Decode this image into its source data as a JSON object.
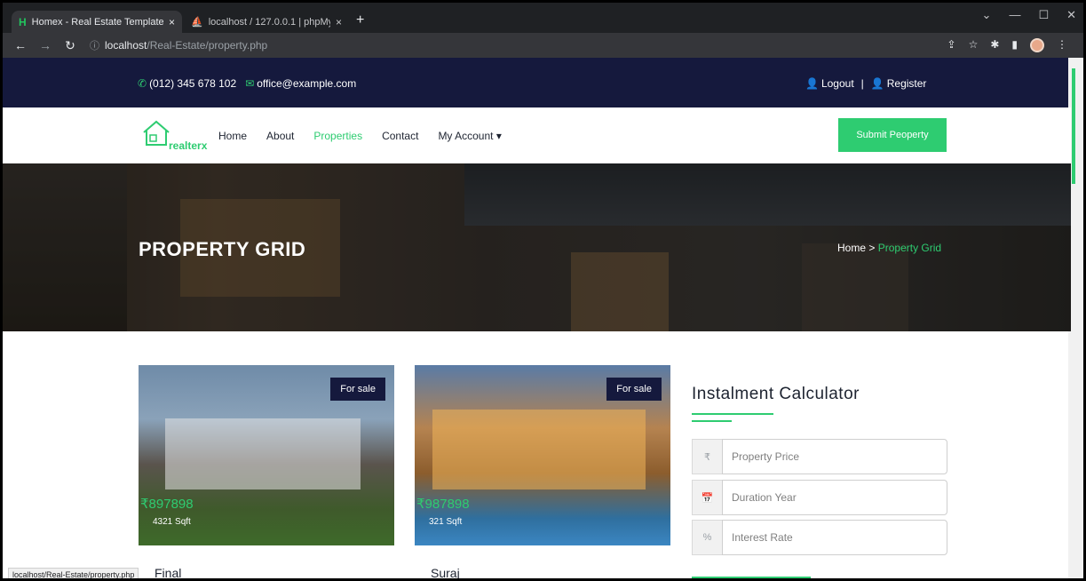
{
  "browser": {
    "tabs": [
      {
        "label": "Homex - Real Estate Template",
        "close": "×",
        "favicon": "H"
      },
      {
        "label": "localhost / 127.0.0.1 | phpMyAdm",
        "close": "×",
        "favicon": "⛵"
      }
    ],
    "new_tab": "+",
    "url_host": "localhost",
    "url_path": "/Real-Estate/property.php",
    "status_url": "localhost/Real-Estate/property.php"
  },
  "topbar": {
    "phone": "(012) 345 678 102",
    "email": "office@example.com",
    "logout": "Logout",
    "separator": "|",
    "register": "Register"
  },
  "navbar": {
    "logo_text": "realterx",
    "menu": [
      "Home",
      "About",
      "Properties",
      "Contact",
      "My Account"
    ],
    "active_index": 2,
    "dropdown_caret": "▾",
    "submit_label": "Submit Peoperty"
  },
  "hero": {
    "title": "PROPERTY GRID",
    "breadcrumb_home": "Home",
    "breadcrumb_sep": ">",
    "breadcrumb_current": "Property Grid"
  },
  "listings": [
    {
      "badge": "For sale",
      "price": "₹897898",
      "area": "4321 Sqft",
      "title": "Final"
    },
    {
      "badge": "For sale",
      "price": "₹987898",
      "area": "321 Sqft",
      "title": "Suraj"
    }
  ],
  "calculator": {
    "title": "Instalment Calculator",
    "price_icon": "₹",
    "price_placeholder": "Property Price",
    "duration_icon": "📅",
    "duration_placeholder": "Duration Year",
    "rate_icon": "%",
    "rate_placeholder": "Interest Rate"
  },
  "colors": {
    "accent": "#2ecc71",
    "navy": "#15193d"
  }
}
